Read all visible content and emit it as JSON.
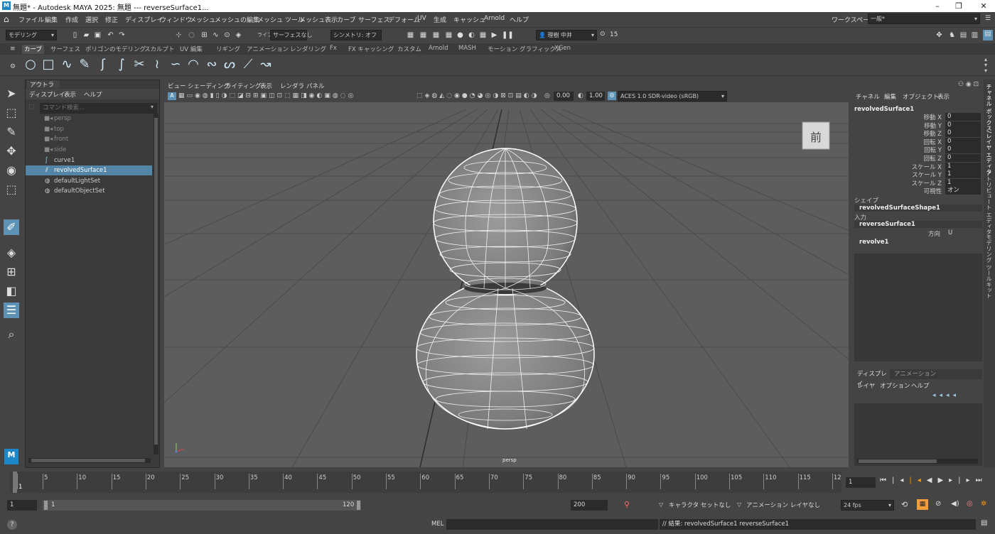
{
  "window": {
    "title": "無題* - Autodesk MAYA 2025: 無題   ---   reverseSurface1...",
    "logo": "M",
    "minimize": "–",
    "maximize": "❐",
    "close": "✕"
  },
  "menubar": {
    "home_icon": "home-icon",
    "items": [
      "ファイル",
      "編集",
      "作成",
      "選択",
      "修正",
      "ディスプレイ",
      "ウィンドウ",
      "メッシュ",
      "メッシュの編集",
      "メッシュ ツール",
      "メッシュ表示",
      "カーブ",
      "サーフェス",
      "デフォーム",
      "UV",
      "生成",
      "キャッシュ",
      "Arnold",
      "ヘルプ"
    ],
    "workspace_label": "ワークスペース:",
    "workspace_value": "一般*"
  },
  "statusline": {
    "mode": "モデリング",
    "live_label": "ライブ",
    "live_value": "サーフェスなし",
    "symmetry": "シンメトリ: オフ",
    "user": "理樹 中井",
    "notifications": "15"
  },
  "shelf": {
    "tabs": [
      "カーブ",
      "サーフェス",
      "ポリゴンのモデリング",
      "スカルプト",
      "UV 編集",
      "リギング",
      "アニメーション",
      "レンダリング",
      "Fx",
      "FX キャッシング",
      "カスタム",
      "Arnold",
      "MASH",
      "モーション グラフィックス",
      "XGen"
    ],
    "active_tab": "カーブ"
  },
  "outliner": {
    "panel_title": "アウトライナ",
    "menus": [
      "ディスプレイ",
      "表示",
      "ヘルプ"
    ],
    "search_placeholder": "コマンド検索...",
    "items": [
      {
        "label": "persp",
        "icon": "camera-icon",
        "dim": true
      },
      {
        "label": "top",
        "icon": "camera-icon",
        "dim": true
      },
      {
        "label": "front",
        "icon": "camera-icon",
        "dim": true
      },
      {
        "label": "side",
        "icon": "camera-icon",
        "dim": true
      },
      {
        "label": "curve1",
        "icon": "curve-icon",
        "dim": false
      },
      {
        "label": "revolvedSurface1",
        "icon": "surface-icon",
        "dim": false,
        "selected": true
      },
      {
        "label": "defaultLightSet",
        "icon": "set-icon",
        "dim": false
      },
      {
        "label": "defaultObjectSet",
        "icon": "set-icon",
        "dim": false
      }
    ]
  },
  "viewport": {
    "menus": [
      "ビュー",
      "シェーディング",
      "ライティング",
      "表示",
      "レンダラ",
      "パネル"
    ],
    "exposure": "0.00",
    "gamma": "1.00",
    "colorspace": "ACES 1.0 SDR-video (sRGB)",
    "camera_label": "persp",
    "viewcube_label": "前"
  },
  "channelbox": {
    "menus": [
      "チャネル",
      "編集",
      "オブジェクト",
      "表示"
    ],
    "object_name": "revolvedSurface1",
    "attributes": [
      {
        "name": "移動 X",
        "value": "0"
      },
      {
        "name": "移動 Y",
        "value": "0"
      },
      {
        "name": "移動 Z",
        "value": "0"
      },
      {
        "name": "回転 X",
        "value": "0"
      },
      {
        "name": "回転 Y",
        "value": "0"
      },
      {
        "name": "回転 Z",
        "value": "0"
      },
      {
        "name": "スケール X",
        "value": "1"
      },
      {
        "name": "スケール Y",
        "value": "1"
      },
      {
        "name": "スケール Z",
        "value": "1"
      },
      {
        "name": "可視性",
        "value": "オン"
      }
    ],
    "shapes_label": "シェイプ",
    "shape_name": "revolvedSurfaceShape1",
    "inputs_label": "入力",
    "input1": "reverseSurface1",
    "input1_attr_name": "方向",
    "input1_attr_value": "U",
    "input2": "revolve1"
  },
  "layer_editor": {
    "tabs": [
      "ディスプレイ",
      "アニメーション"
    ],
    "menus": [
      "レイヤ",
      "オプション",
      "ヘルプ"
    ]
  },
  "right_rail": [
    "チャネル ボックス/レイヤ エディタ",
    "アトリビュート エディタ",
    "モデリング ツールキット"
  ],
  "timeline": {
    "ticks": [
      "1",
      "5",
      "10",
      "15",
      "20",
      "25",
      "30",
      "35",
      "40",
      "45",
      "50",
      "55",
      "60",
      "65",
      "70",
      "75",
      "80",
      "85",
      "90",
      "95",
      "100",
      "105",
      "110",
      "115",
      "12"
    ],
    "current_frame": "1"
  },
  "range": {
    "start": "1",
    "inner_start": "1",
    "inner_end": "120",
    "end": "200",
    "character_set": "キャラクタ セットなし",
    "anim_layer": "アニメーション レイヤなし",
    "fps": "24 fps"
  },
  "cmdline": {
    "lang": "MEL",
    "result": "// 結果: revolvedSurface1 reverseSurface1"
  }
}
